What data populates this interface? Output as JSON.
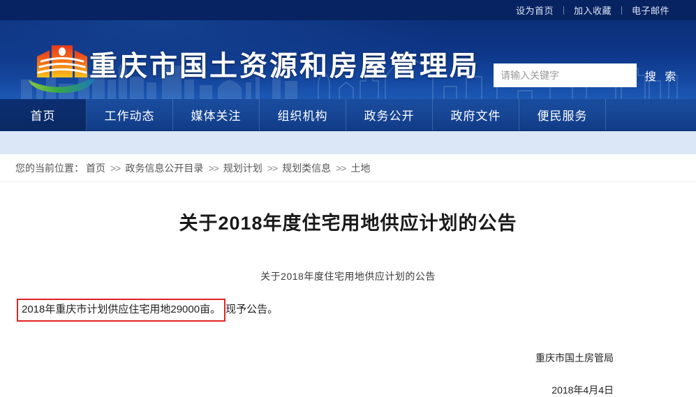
{
  "topbar": {
    "links": [
      {
        "label": "设为首页",
        "name": "set-homepage-link"
      },
      {
        "label": "加入收藏",
        "name": "add-favorite-link"
      },
      {
        "label": "电子邮件",
        "name": "email-link"
      }
    ]
  },
  "header": {
    "site_title": "重庆市国土资源和房屋管理局",
    "logo_alt": "chongqing-land-housing-emblem",
    "search": {
      "placeholder": "请输入关键字",
      "value": "",
      "button_label": "搜 索"
    }
  },
  "nav": {
    "items": [
      {
        "label": "首页",
        "active": true
      },
      {
        "label": "工作动态",
        "active": false
      },
      {
        "label": "媒体关注",
        "active": false
      },
      {
        "label": "组织机构",
        "active": false
      },
      {
        "label": "政务公开",
        "active": false
      },
      {
        "label": "政府文件",
        "active": false
      },
      {
        "label": "便民服务",
        "active": false
      }
    ]
  },
  "breadcrumb": {
    "label": "您的当前位置：",
    "separator": ">>",
    "items": [
      "首页",
      "政务信息公开目录",
      "规划计划",
      "规划类信息",
      "土地"
    ]
  },
  "article": {
    "title": "关于2018年度住宅用地供应计划的公告",
    "subtitle": "关于2018年度住宅用地供应计划的公告",
    "highlighted_text": "2018年重庆市计划供应住宅用地29000亩。",
    "paragraph_tail": "现予公告。",
    "signature": "重庆市国土房管局",
    "date": "2018年4月4日"
  },
  "colors": {
    "topbar_bg": "#082361",
    "header_blue": "#0e378a",
    "nav_blue": "#164593",
    "nav_active": "#0a2a68",
    "strip_blue": "#dbe7f7",
    "highlight_border": "#e02323",
    "logo_orange": "#f0761e",
    "logo_red": "#e03a1c",
    "logo_green": "#3fae49"
  }
}
